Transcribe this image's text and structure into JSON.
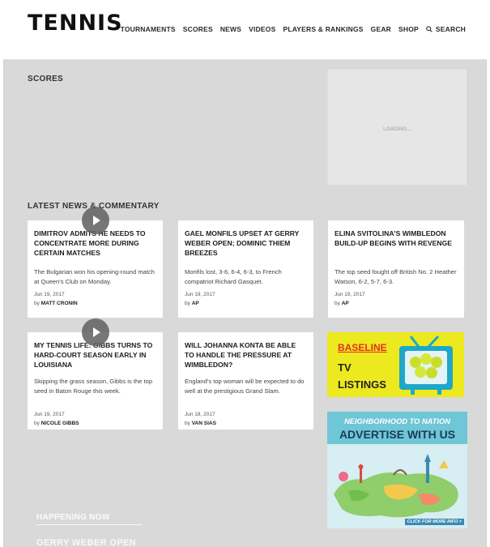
{
  "header": {
    "logo": "TENNIS",
    "nav": [
      {
        "label": "TOURNAMENTS"
      },
      {
        "label": "SCORES"
      },
      {
        "label": "NEWS"
      },
      {
        "label": "VIDEOS"
      },
      {
        "label": "PLAYERS & RANKINGS"
      },
      {
        "label": "GEAR"
      },
      {
        "label": "SHOP"
      },
      {
        "label": "SEARCH",
        "icon": "search-icon"
      }
    ]
  },
  "scores": {
    "heading": "SCORES",
    "ad_placeholder": "LOADING..."
  },
  "news": {
    "heading": "LATEST NEWS & COMMENTARY",
    "cards": [
      {
        "title": "DIMITROV ADMITS HE NEEDS TO CONCENTRATE MORE DURING CERTAIN MATCHES",
        "desc": "The Bulgarian won his opening-round match at Queen's Club on Monday.",
        "date": "Jun 19, 2017",
        "by_prefix": "by",
        "author": "MATT CRONIN",
        "has_video": true
      },
      {
        "title": "GAEL MONFILS UPSET AT GERRY WEBER OPEN; DOMINIC THIEM BREEZES",
        "desc": "Monfils lost, 3-6, 6-4, 6-3, to French compatriot Richard Gasquet.",
        "date": "Jun 19, 2017",
        "by_prefix": "by",
        "author": "AP",
        "has_video": false
      },
      {
        "title": "ELINA SVITOLINA'S WIMBLEDON BUILD-UP BEGINS WITH REVENGE",
        "desc": "The top seed fought off British No. 2 Heather Watson, 6-2, 5-7, 6-3.",
        "date": "Jun 19, 2017",
        "by_prefix": "by",
        "author": "AP",
        "has_video": false
      },
      {
        "title": "MY TENNIS LIFE: GIBBS TURNS TO HARD-COURT SEASON EARLY IN LOUISIANA",
        "desc": "Skipping the grass season, Gibbs is the top seed in Baton Rouge this week.",
        "date": "Jun 19, 2017",
        "by_prefix": "by",
        "author": "NICOLE GIBBS",
        "has_video": true
      },
      {
        "title": "WILL JOHANNA KONTA BE ABLE TO HANDLE THE PRESSURE AT WIMBLEDON?",
        "desc": "England's top woman will be expected to do well at the prestigious Grand Slam.",
        "date": "Jun 18, 2017",
        "by_prefix": "by",
        "author": "VAN SIAS",
        "has_video": false
      }
    ]
  },
  "ads": {
    "baseline": {
      "brand": "BASELINE",
      "line1": "TV",
      "line2": "LISTINGS"
    },
    "nation": {
      "line1": "NEIGHBORHOOD TO NATION",
      "line2": "ADVERTISE WITH US",
      "cta": "CLICK FOR MORE INFO >"
    }
  },
  "happening": {
    "heading": "HAPPENING NOW",
    "event": "GERRY WEBER OPEN"
  },
  "colors": {
    "page_bg": "#d9d9d9",
    "card_bg": "#ffffff",
    "baseline_yellow": "#ede91f",
    "baseline_red": "#e52d21",
    "nation_blue": "#6ec6d6"
  }
}
